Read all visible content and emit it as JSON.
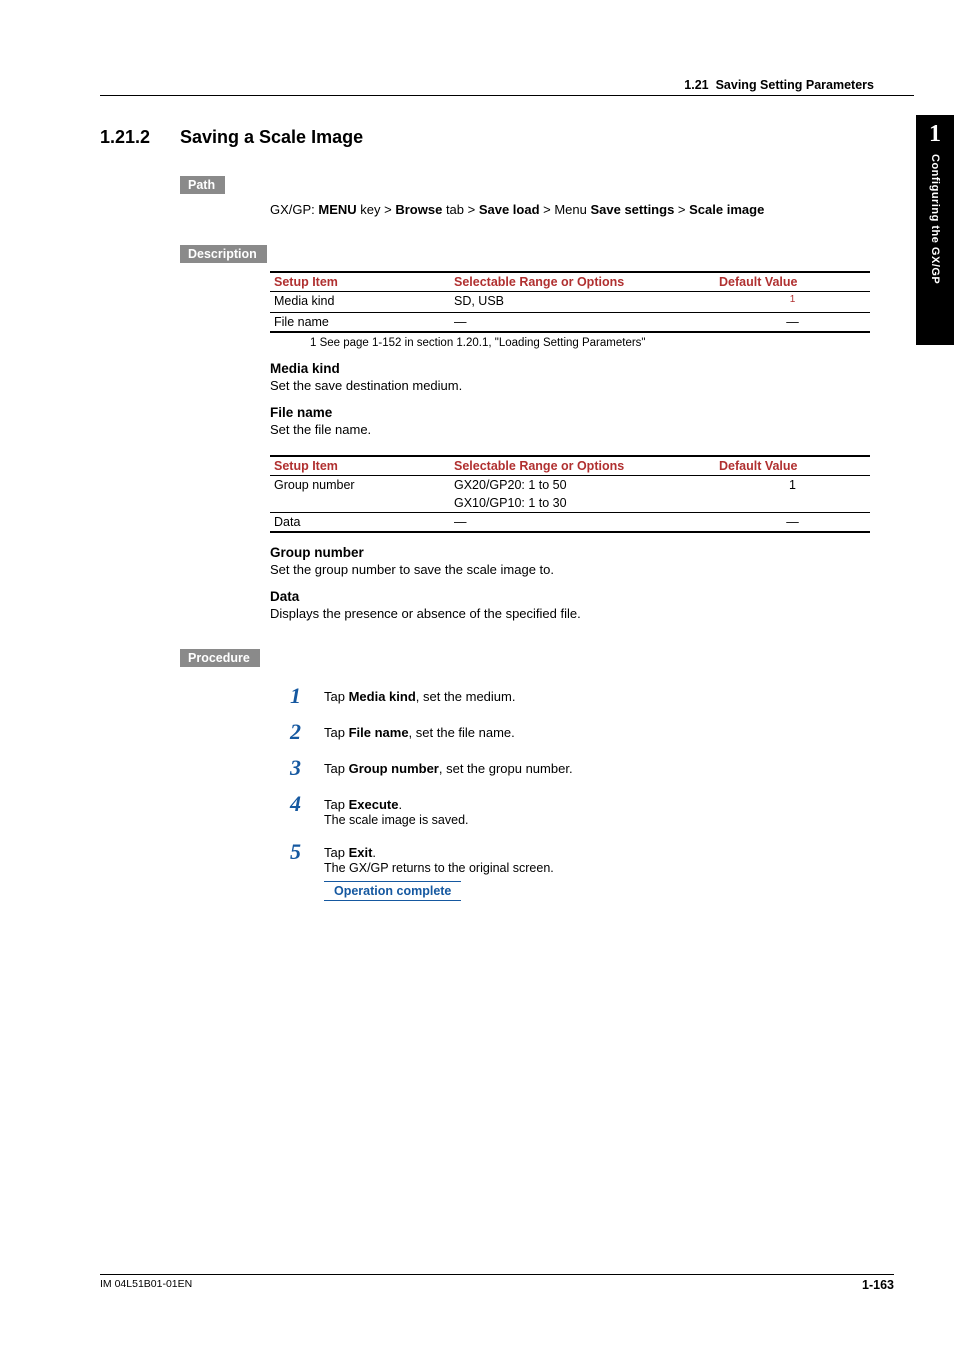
{
  "running_head": {
    "num": "1.21",
    "title": "Saving Setting Parameters"
  },
  "side_tab": {
    "num": "1",
    "label": "Configuring the GX/GP"
  },
  "section": {
    "num": "1.21.2",
    "title": "Saving a Scale Image"
  },
  "labels": {
    "path": "Path",
    "description": "Description",
    "procedure": "Procedure"
  },
  "path": {
    "prefix": "GX/GP: ",
    "p1": "MENU",
    "t1": " key > ",
    "p2": "Browse",
    "t2": " tab > ",
    "p3": "Save load",
    "t3": " > Menu ",
    "p4": "Save settings",
    "t4": " > ",
    "p5": "Scale image"
  },
  "table_head": {
    "c1": "Setup Item",
    "c2": "Selectable Range or Options",
    "c3": "Default Value"
  },
  "table1": {
    "r1": {
      "item": "Media kind",
      "range": "SD, USB",
      "def_sup": "1"
    },
    "r2": {
      "item": "File name",
      "range": "—",
      "def": "—"
    }
  },
  "footnote1": "1   See page 1-152 in section 1.20.1, \"Loading Setting Parameters\"",
  "desc1": {
    "h1": "Media kind",
    "t1": "Set the save destination medium.",
    "h2": "File name",
    "t2": "Set the file name."
  },
  "table2": {
    "r1": {
      "item": "Group number",
      "range1": "GX20/GP20: 1 to 50",
      "range2": "GX10/GP10: 1 to 30",
      "def": "1"
    },
    "r2": {
      "item": "Data",
      "range": "—",
      "def": "—"
    }
  },
  "desc2": {
    "h1": "Group number",
    "t1": "Set the group number to save the scale image to.",
    "h2": "Data",
    "t2": "Displays the presence or absence of the specified file."
  },
  "proc": {
    "s1": {
      "n": "1",
      "pre": "Tap ",
      "b": "Media kind",
      "post": ", set the medium."
    },
    "s2": {
      "n": "2",
      "pre": "Tap ",
      "b": "File name",
      "post": ", set the file name."
    },
    "s3": {
      "n": "3",
      "pre": "Tap ",
      "b": "Group number",
      "post": ", set the gropu number."
    },
    "s4": {
      "n": "4",
      "pre": "Tap ",
      "b": "Execute",
      "post": ".",
      "sub": "The scale image is saved."
    },
    "s5": {
      "n": "5",
      "pre": "Tap ",
      "b": "Exit",
      "post": ".",
      "sub": "The GX/GP returns to the original screen."
    }
  },
  "op_complete": "Operation complete",
  "footer": {
    "left": "IM 04L51B01-01EN",
    "right": "1-163"
  }
}
